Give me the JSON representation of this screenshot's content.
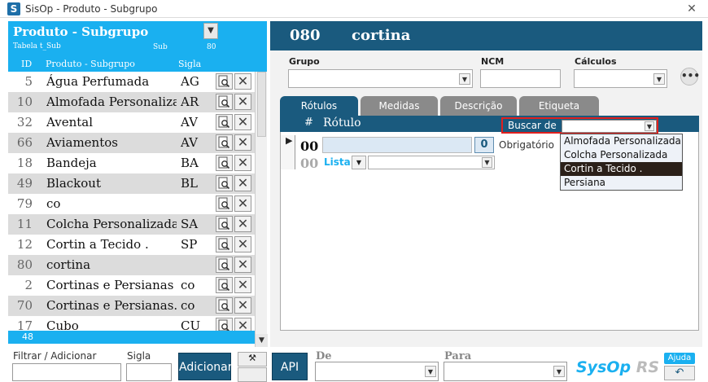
{
  "window": {
    "title": "SisOp - Produto - Subgrupo",
    "icon": "S",
    "close": "✕"
  },
  "left": {
    "title": "Produto - Subgrupo",
    "table_label": "Tabela",
    "table_name": "t_Sub",
    "sub_label": "Sub",
    "sub_value": "80",
    "columns": {
      "id": "ID",
      "name": "Produto - Subgrupo",
      "sigla": "Sigla"
    },
    "rows": [
      {
        "id": "5",
        "name": "Água Perfumada",
        "sigla": "AG"
      },
      {
        "id": "10",
        "name": "Almofada Personalizada",
        "sigla": "AR"
      },
      {
        "id": "32",
        "name": "Avental",
        "sigla": "AV"
      },
      {
        "id": "66",
        "name": "Aviamentos",
        "sigla": "AV"
      },
      {
        "id": "18",
        "name": "Bandeja",
        "sigla": "BA"
      },
      {
        "id": "49",
        "name": "Blackout",
        "sigla": "BL"
      },
      {
        "id": "79",
        "name": "co",
        "sigla": ""
      },
      {
        "id": "11",
        "name": "Colcha Personalizada",
        "sigla": "SA"
      },
      {
        "id": "12",
        "name": "Cortin a Tecido .",
        "sigla": "SP"
      },
      {
        "id": "80",
        "name": "cortina",
        "sigla": ""
      },
      {
        "id": "2",
        "name": "Cortinas e Persianas",
        "sigla": "co"
      },
      {
        "id": "70",
        "name": "Cortinas e Persianas.",
        "sigla": "co"
      },
      {
        "id": "17",
        "name": "Cubo",
        "sigla": "CU"
      }
    ],
    "count": "48"
  },
  "bottom": {
    "filter_label": "Filtrar / Adicionar",
    "sigla_label": "Sigla",
    "adicionar": "Adicionar",
    "api": "API",
    "de_label": "De",
    "para_label": "Para",
    "brand_main": "SysOp",
    "brand_suffix": " RS",
    "ajuda": "Ajuda",
    "back_icon": "↶"
  },
  "record": {
    "code": "080",
    "name": "cortina",
    "grupo_label": "Grupo",
    "ncm_label": "NCM",
    "calculos_label": "Cálculos",
    "more": "•••"
  },
  "tabs": [
    {
      "label": "Rótulos",
      "active": true
    },
    {
      "label": "Medidas",
      "active": false
    },
    {
      "label": "Descrição",
      "active": false
    },
    {
      "label": "Etiqueta",
      "active": false
    }
  ],
  "grid": {
    "hash": "#",
    "rotulo": "Rótulo",
    "buscar_label": "Buscar de",
    "row_marker": "▶",
    "row1_num": "00",
    "row1_count": "0",
    "row1_obrig": "Obrigatório",
    "row2_num": "00",
    "row2_lista": "Lista"
  },
  "dropdown": {
    "options": [
      {
        "label": "Almofada Personalizada",
        "selected": false
      },
      {
        "label": "Colcha Personalizada",
        "selected": false
      },
      {
        "label": "Cortin a Tecido .",
        "selected": true
      },
      {
        "label": "Persiana",
        "selected": false
      }
    ]
  },
  "colors": {
    "accent": "#1ab0f0",
    "dark": "#1a5a7e",
    "highlight": "#e0201e"
  },
  "icons": [
    "preview-icon",
    "delete-icon",
    "chevron-down-icon",
    "tools-icon",
    "undo-icon"
  ]
}
